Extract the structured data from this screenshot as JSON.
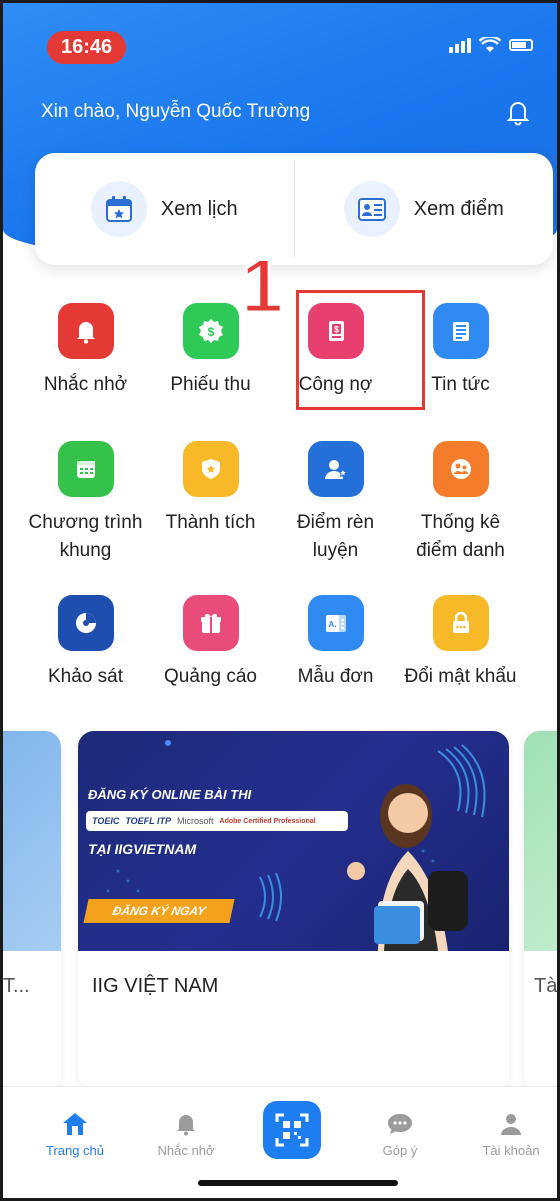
{
  "status": {
    "time": "16:46"
  },
  "header": {
    "greeting": "Xin chào, Nguyễn Quốc Trường"
  },
  "quick_actions": [
    {
      "label": "Xem lịch",
      "icon": "calendar-icon"
    },
    {
      "label": "Xem điểm",
      "icon": "grades-card-icon"
    }
  ],
  "annotation": {
    "marker": "1",
    "highlight_color": "#e53935"
  },
  "menu": [
    {
      "label": "Nhắc nhở",
      "icon": "bell-icon",
      "color": "#e53935"
    },
    {
      "label": "Phiếu thu",
      "icon": "receipt-icon",
      "color": "#2ec957"
    },
    {
      "label": "Công nợ",
      "icon": "debt-icon",
      "color": "#e8406e"
    },
    {
      "label": "Tin tức",
      "icon": "news-icon",
      "color": "#2f8af3"
    },
    {
      "label": "Chương trình khung",
      "icon": "curriculum-icon",
      "color": "#35c24a"
    },
    {
      "label": "Thành tích",
      "icon": "achievement-icon",
      "color": "#f7b928"
    },
    {
      "label": "Điểm rèn luyện",
      "icon": "training-score-icon",
      "color": "#2470d8"
    },
    {
      "label": "Thống kê điểm danh",
      "icon": "attendance-icon",
      "color": "#f57c2a"
    },
    {
      "label": "Khảo sát",
      "icon": "survey-icon",
      "color": "#1e4fb0"
    },
    {
      "label": "Quảng cáo",
      "icon": "gift-icon",
      "color": "#ea4c7a"
    },
    {
      "label": "Mẫu đơn",
      "icon": "form-icon",
      "color": "#2f8af3"
    },
    {
      "label": "Đổi mật khẩu",
      "icon": "lock-icon",
      "color": "#f7b928"
    }
  ],
  "banner": {
    "headline": "ĐĂNG KÝ ONLINE BÀI THI",
    "brands": [
      "TOEIC",
      "TOEFL ITP",
      "Microsoft",
      "Adobe Certified Professional"
    ],
    "subline": "TẠI IIGVIETNAM",
    "cta": "ĐĂNG KÝ NGAY",
    "title": "IIG VIỆT NAM"
  },
  "side_cards": {
    "left_caption": "T...",
    "right_caption": "Tài"
  },
  "tabs": [
    {
      "label": "Trang chủ",
      "icon": "home-icon",
      "active": true
    },
    {
      "label": "Nhắc nhở",
      "icon": "bell-icon",
      "active": false
    },
    {
      "label": "Góp ý",
      "icon": "chat-icon",
      "active": false
    },
    {
      "label": "Tài khoản",
      "icon": "user-icon",
      "active": false
    }
  ]
}
